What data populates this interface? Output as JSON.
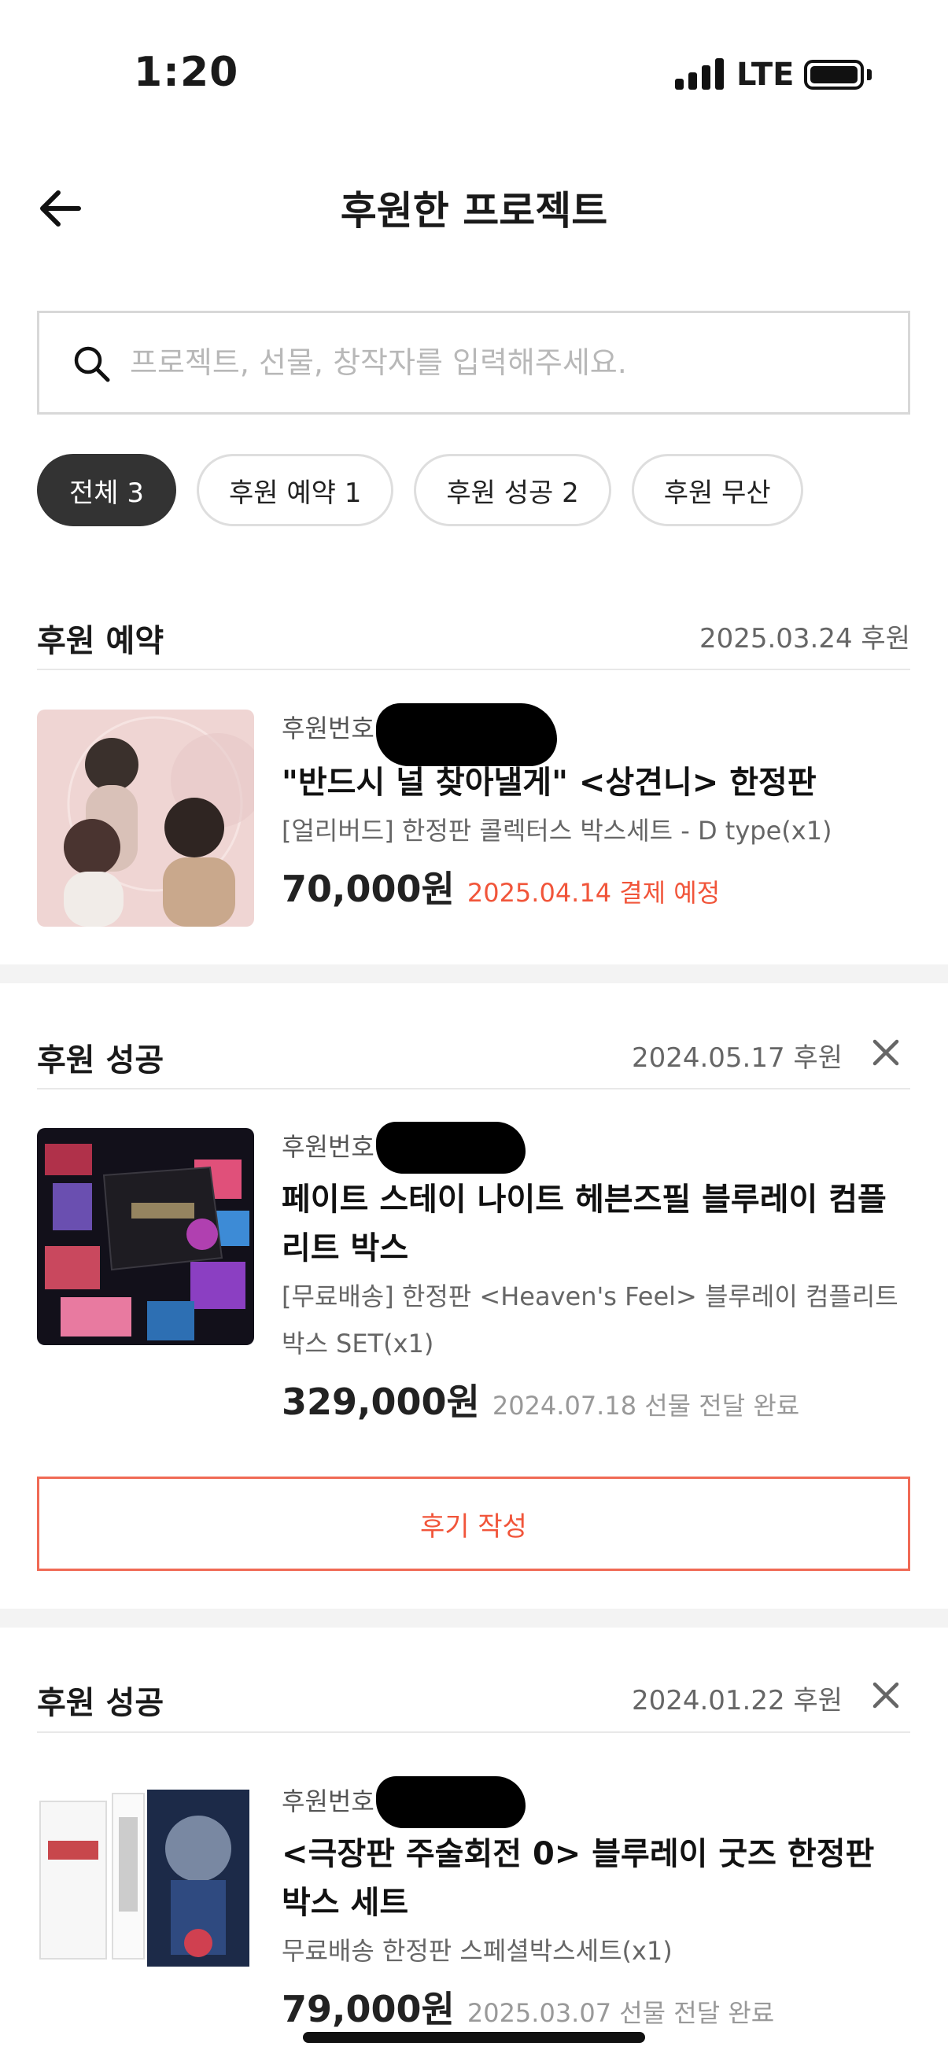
{
  "status_bar": {
    "time": "1:20",
    "network": "LTE"
  },
  "header": {
    "title": "후원한 프로젝트"
  },
  "search": {
    "placeholder": "프로젝트, 선물, 창작자를 입력해주세요."
  },
  "filters": [
    {
      "label": "전체 3",
      "active": true
    },
    {
      "label": "후원 예약 1",
      "active": false
    },
    {
      "label": "후원 성공 2",
      "active": false
    },
    {
      "label": "후원 무산",
      "active": false
    }
  ],
  "pledges": [
    {
      "status": "후원 예약",
      "date": "2025.03.24 후원",
      "sponsor_no_label": "후원번호",
      "title": "\"반드시 널 찾아낼게\" <상견니> 한정판",
      "reward": "[얼리버드] 한정판 콜렉터스 박스세트 - D type(x1)",
      "price": "70,000원",
      "note": "2025.04.14 결제 예정"
    },
    {
      "status": "후원 성공",
      "date": "2024.05.17 후원",
      "sponsor_no_label": "후원번호",
      "title": "페이트 스테이 나이트 헤븐즈필 블루레이 컴플리트 박스",
      "reward": "[무료배송] 한정판 <Heaven's Feel> 블루레이 컴플리트 박스 SET(x1)",
      "price": "329,000원",
      "note": "2024.07.18 선물 전달 완료",
      "review_label": "후기 작성"
    },
    {
      "status": "후원 성공",
      "date": "2024.01.22 후원",
      "sponsor_no_label": "후원번호",
      "title": "<극장판 주술회전 0> 블루레이 굿즈 한정판 박스 세트",
      "reward": "무료배송 한정판 스페셜박스세트(x1)",
      "price": "79,000원",
      "note": "2025.03.07 선물 전달 완료"
    }
  ],
  "colors": {
    "accent": "#f1553a",
    "chip_active": "#333333",
    "divider": "#e8e8e8"
  },
  "icons": [
    "back-arrow-icon",
    "search-icon",
    "close-icon",
    "signal-icon",
    "battery-icon"
  ]
}
